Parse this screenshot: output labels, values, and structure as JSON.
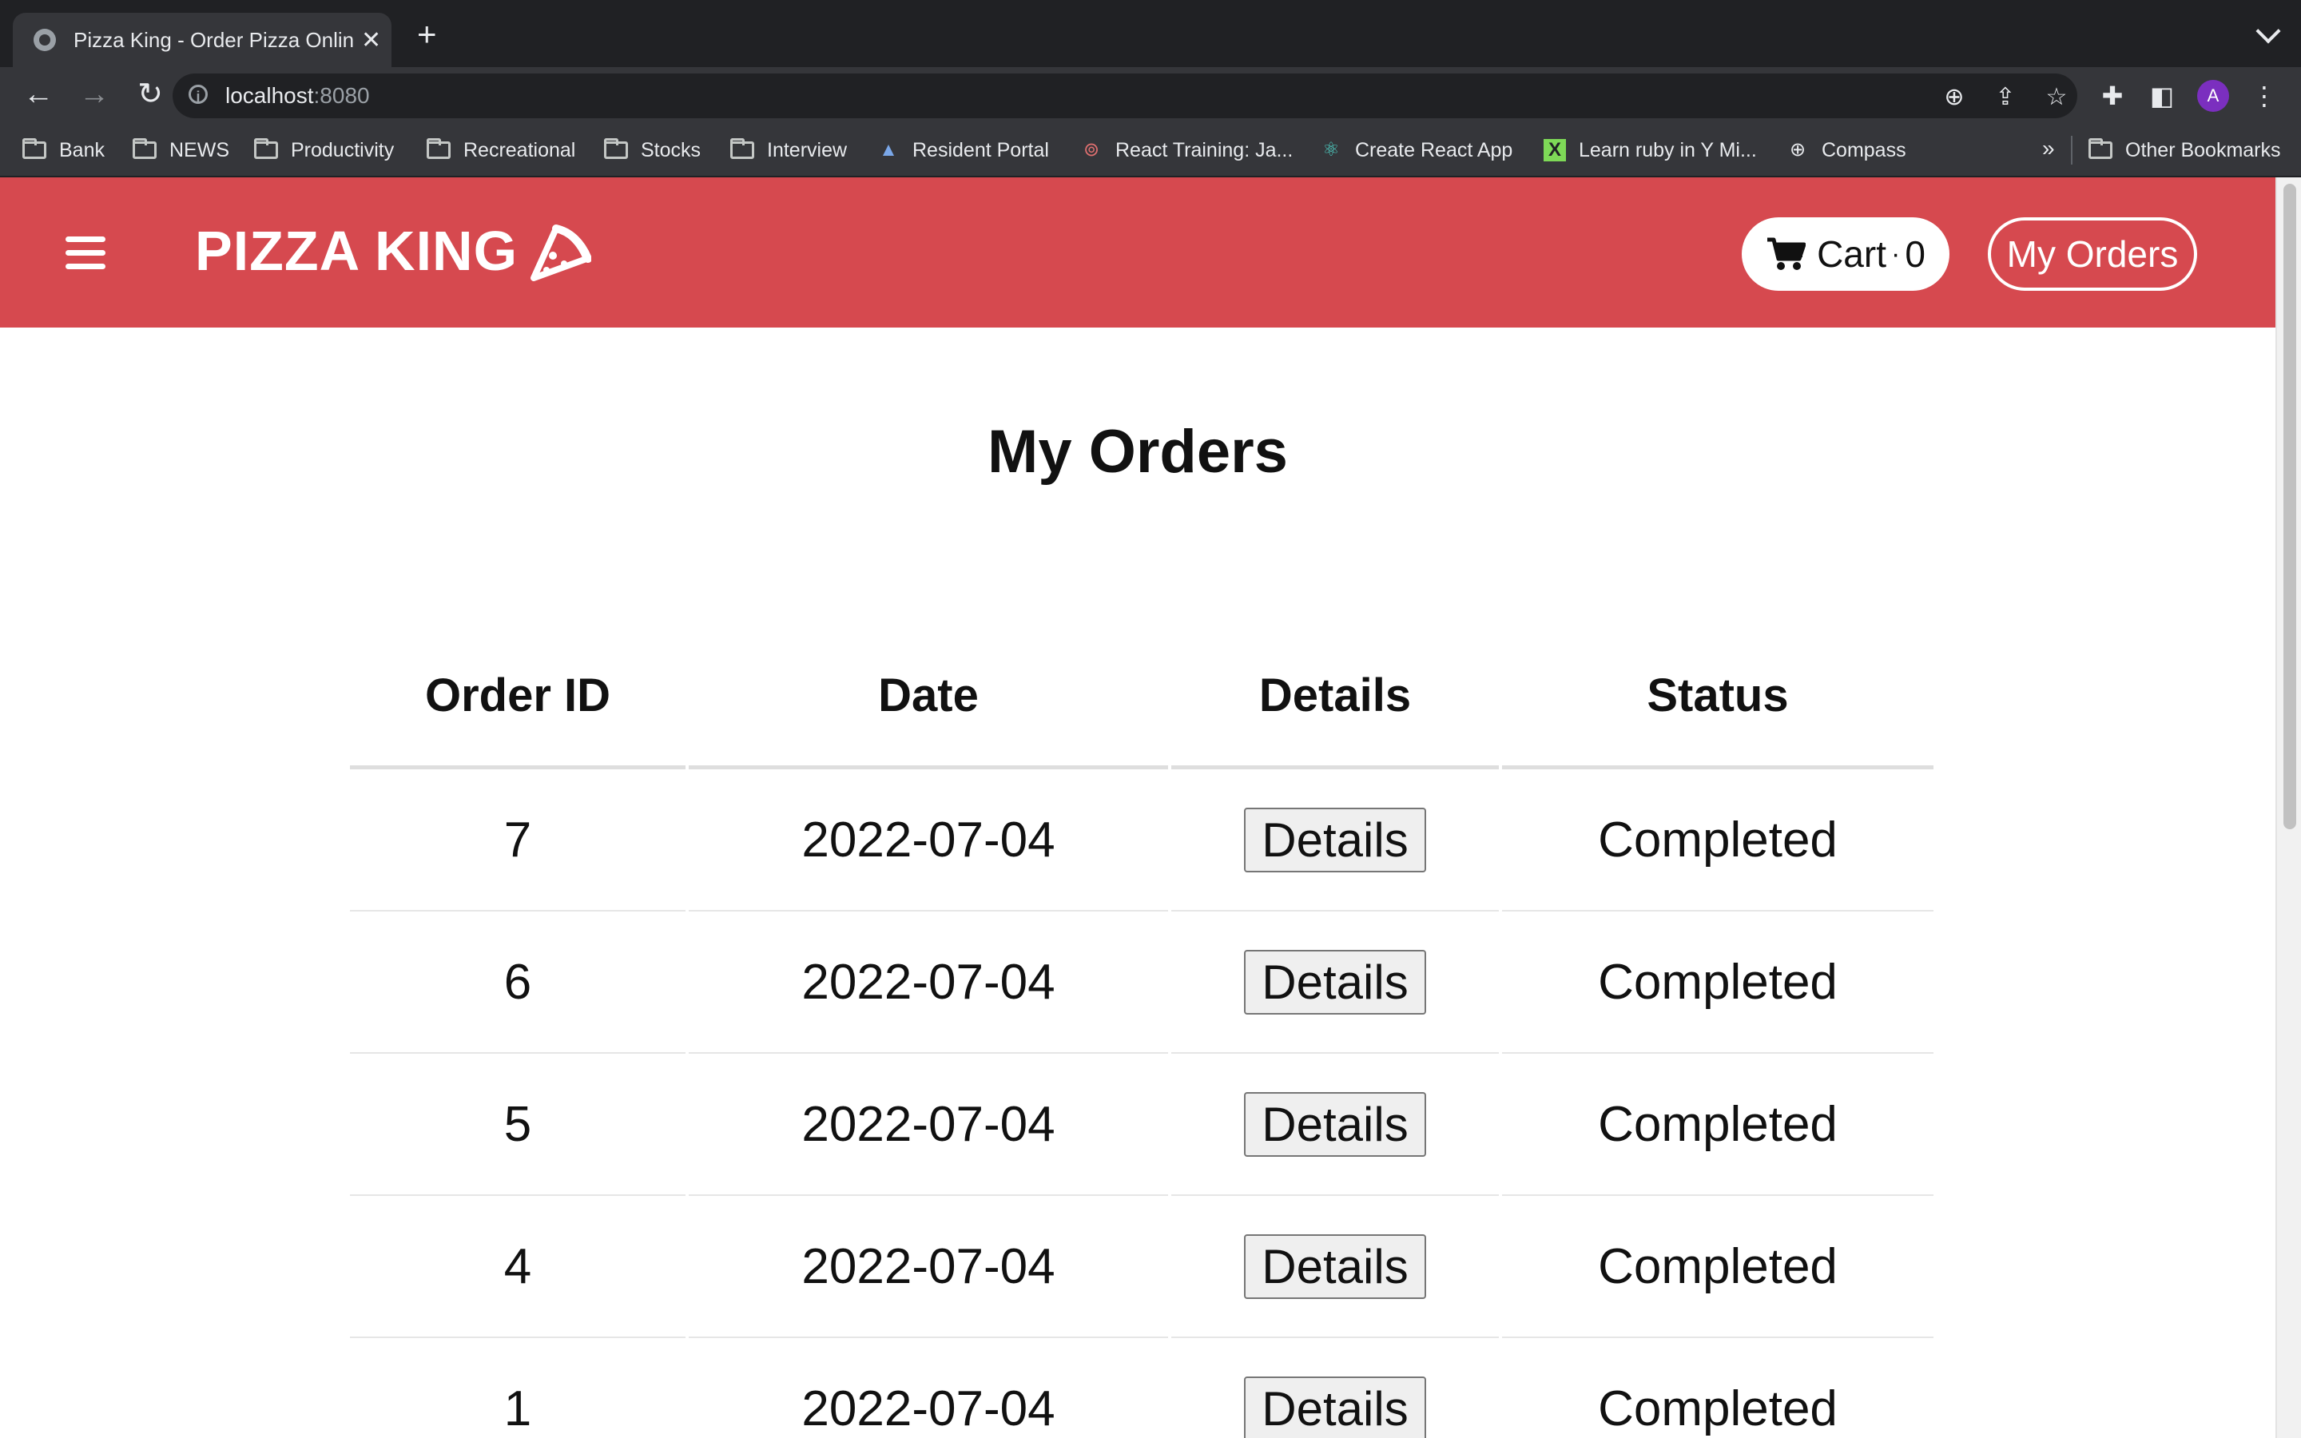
{
  "browser": {
    "tab_title": "Pizza King - Order Pizza Online",
    "url_host": "localhost",
    "url_port": ":8080",
    "profile_initial": "A",
    "bookmarks": [
      {
        "label": "Bank",
        "icon": "folder-icon"
      },
      {
        "label": "NEWS",
        "icon": "folder-icon"
      },
      {
        "label": "Productivity",
        "icon": "folder-icon"
      },
      {
        "label": "Recreational",
        "icon": "folder-icon"
      },
      {
        "label": "Stocks",
        "icon": "folder-icon"
      },
      {
        "label": "Interview",
        "icon": "folder-icon"
      },
      {
        "label": "Resident Portal",
        "icon": "drive-icon"
      },
      {
        "label": "React Training: Ja...",
        "icon": "react-training-icon"
      },
      {
        "label": "Create React App",
        "icon": "react-icon"
      },
      {
        "label": "Learn ruby in Y Mi...",
        "icon": "learnx-icon"
      },
      {
        "label": "Compass",
        "icon": "compass-icon"
      }
    ],
    "more_bookmarks": "»",
    "other_bookmarks": "Other Bookmarks"
  },
  "header": {
    "brand": "PIZZA KING",
    "cart_label": "Cart",
    "cart_separator": "·",
    "cart_count": "0",
    "my_orders_label": "My Orders",
    "colors": {
      "brand_bg": "#d6494f"
    }
  },
  "main": {
    "title": "My Orders",
    "columns": [
      "Order ID",
      "Date",
      "Details",
      "Status"
    ],
    "rows": [
      {
        "id": "7",
        "date": "2022-07-04",
        "details_label": "Details",
        "status": "Completed"
      },
      {
        "id": "6",
        "date": "2022-07-04",
        "details_label": "Details",
        "status": "Completed"
      },
      {
        "id": "5",
        "date": "2022-07-04",
        "details_label": "Details",
        "status": "Completed"
      },
      {
        "id": "4",
        "date": "2022-07-04",
        "details_label": "Details",
        "status": "Completed"
      },
      {
        "id": "1",
        "date": "2022-07-04",
        "details_label": "Details",
        "status": "Completed"
      }
    ]
  }
}
